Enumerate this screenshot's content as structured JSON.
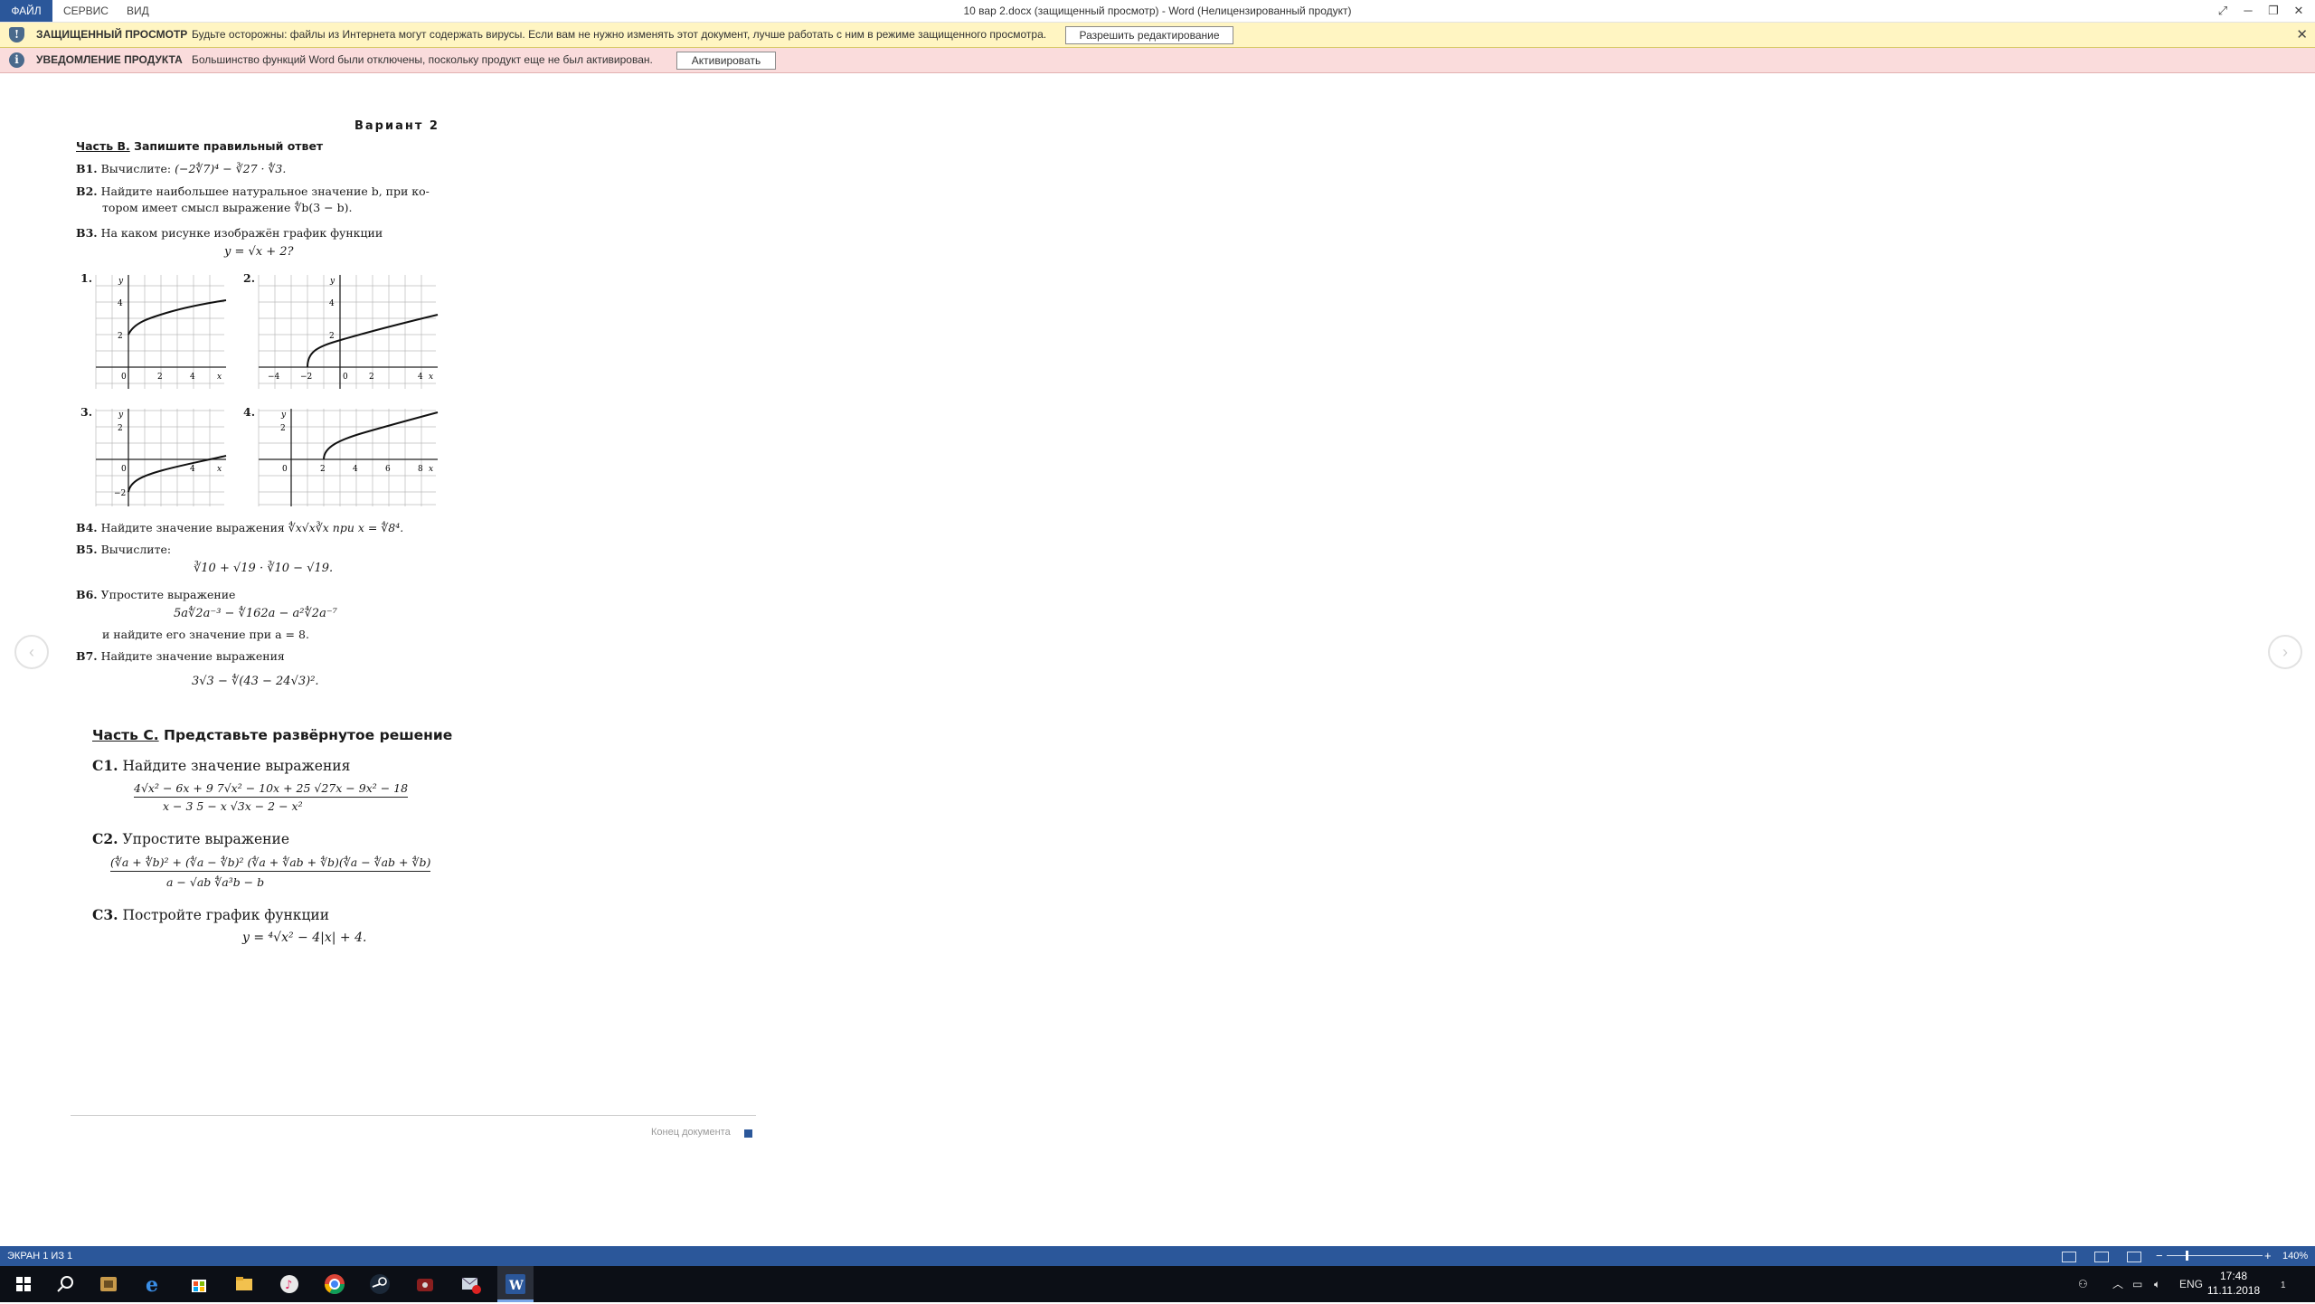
{
  "titlebar": {
    "menu": [
      "ФАЙЛ",
      "СЕРВИС",
      "ВИД"
    ],
    "title": "10 вар 2.docx (защищенный просмотр) - Word (Нелицензированный продукт)"
  },
  "protected_bar": {
    "title": "ЗАЩИЩЕННЫЙ ПРОСМОТР",
    "text": "Будьте осторожны: файлы из Интернета могут содержать вирусы. Если вам не нужно изменять этот документ, лучше работать с ним в режиме защищенного просмотра.",
    "button": "Разрешить редактирование"
  },
  "notice_bar": {
    "title": "УВЕДОМЛЕНИЕ ПРОДУКТА",
    "text": "Большинство функций Word были отключены, поскольку продукт еще не был активирован.",
    "button": "Активировать"
  },
  "doc": {
    "variant": "Вариант 2",
    "partB_label": "Часть B.",
    "partB_title": "Запишите правильный ответ",
    "b1_num": "B1.",
    "b1_text": "Вычислите:",
    "b1_formula": "(−2∜7)⁴ − ∛27 · ∜3.",
    "b2_num": "B2.",
    "b2_text": "Найдите наибольшее натуральное значение b, при ко-",
    "b2_text2": "тором имеет смысл выражение ∜b(3 − b).",
    "b3_num": "B3.",
    "b3_text": "На каком рисунке изображён график функции",
    "b3_formula": "y = √x + 2?",
    "graph_labels": [
      "1.",
      "2.",
      "3.",
      "4."
    ],
    "graph1_ticks": [
      "y",
      "4",
      "2",
      "0",
      "2",
      "4",
      "x"
    ],
    "graph2_ticks": [
      "y",
      "4",
      "2",
      "−4",
      "−2",
      "0",
      "2",
      "4",
      "x"
    ],
    "graph3_ticks": [
      "y",
      "2",
      "0",
      "−2",
      "4",
      "x"
    ],
    "graph4_ticks": [
      "y",
      "2",
      "0",
      "2",
      "4",
      "6",
      "8",
      "x"
    ],
    "b4_num": "B4.",
    "b4_text": "Найдите значение выражения",
    "b4_formula": "∜x√x∛x  при  x = ∜8⁴.",
    "b5_num": "B5.",
    "b5_text": "Вычислите:",
    "b5_formula": "∛10 + √19 · ∛10 − √19.",
    "b6_num": "B6.",
    "b6_text": "Упростите выражение",
    "b6_formula": "5a∜2a⁻³ − ∜162a − a²∜2a⁻⁷",
    "b6_text2": "и найдите его значение при a = 8.",
    "b7_num": "B7.",
    "b7_text": "Найдите значение выражения",
    "b7_formula": "3√3 − ∜(43 − 24√3)².",
    "partC_label": "Часть C.",
    "partC_title": "Представьте развёрнутое решение",
    "c1_num": "C1.",
    "c1_text": "Найдите значение выражения",
    "c1_formula_top": "4√x² − 6x + 9      7√x² − 10x + 25      √27x − 9x² − 18",
    "c1_formula_bottom": "x − 3                 5 − x                √3x − 2 − x²",
    "c2_num": "C2.",
    "c2_text": "Упростите выражение",
    "c2_formula_top": "(∜a + ∜b)² + (∜a − ∜b)²     (∜a + ∜ab + ∜b)(∜a − ∜ab + ∜b)",
    "c2_formula_bottom": "a − √ab                    ∜a³b − b",
    "c3_num": "C3.",
    "c3_text": "Постройте график функции",
    "c3_formula": "y = ⁴√x² − 4|x| + 4.",
    "end_label": "Конец документа"
  },
  "status": {
    "page": "ЭКРАН 1 ИЗ 1",
    "zoom": "140%"
  },
  "taskbar": {
    "lang": "ENG",
    "time": "17:48",
    "date": "11.11.2018",
    "notifications": "1"
  },
  "colors": {
    "accent": "#2b579a",
    "protected_bg": "#fff5c2",
    "notice_bg": "#fadcdc"
  }
}
